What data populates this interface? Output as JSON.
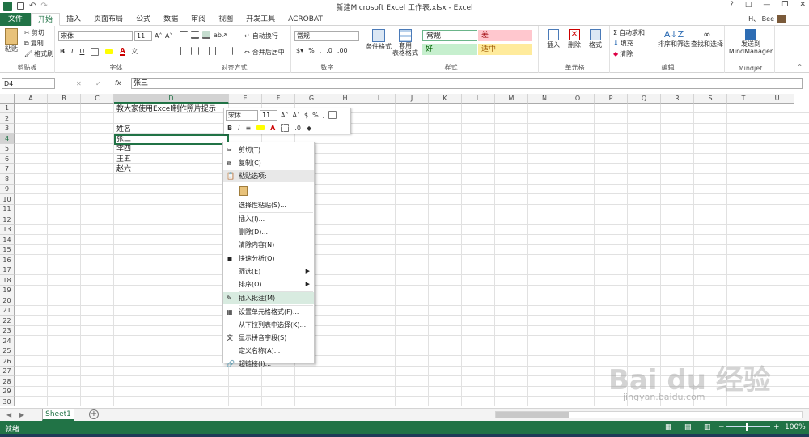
{
  "window": {
    "title": "新建Microsoft Excel 工作表.xlsx - Excel",
    "controls": [
      "?",
      "□",
      "—",
      "❐",
      "✕"
    ],
    "user": "H、 Bee"
  },
  "tabs": [
    "文件",
    "开始",
    "插入",
    "页面布局",
    "公式",
    "数据",
    "审阅",
    "视图",
    "开发工具",
    "ACROBAT"
  ],
  "ribbon": {
    "clipboard": {
      "paste": "粘贴",
      "cut": "剪切",
      "copy": "复制",
      "format_painter": "格式刷",
      "label": "剪贴板"
    },
    "font": {
      "name": "宋体",
      "size": "11",
      "label": "字体",
      "bold": "B",
      "italic": "I",
      "underline": "U",
      "grow": "A˄",
      "shrink": "A˅"
    },
    "alignment": {
      "wrap": "自动换行",
      "merge": "合并后居中",
      "label": "对齐方式"
    },
    "number": {
      "format": "常规",
      "percent": "%",
      "comma": ",",
      "label": "数字"
    },
    "styles": {
      "cond": "条件格式",
      "table": "套用\n表格格式",
      "normal": "常规",
      "bad": "差",
      "good": "好",
      "neutral": "适中",
      "label": "样式"
    },
    "cells": {
      "insert": "插入",
      "delete": "删除",
      "format": "格式",
      "label": "单元格"
    },
    "editing": {
      "autosum": "自动求和",
      "fill": "填充",
      "clear": "清除",
      "sort": "排序和筛选",
      "find": "查找和选择",
      "label": "编辑"
    },
    "mindjet": {
      "send": "发送到\nMindManager",
      "label": "Mindjet"
    }
  },
  "formula_bar": {
    "name_box": "D4",
    "fx": "fx",
    "content": "张三"
  },
  "columns": [
    "A",
    "B",
    "C",
    "D",
    "E",
    "F",
    "G",
    "H",
    "I",
    "J",
    "K",
    "L",
    "M",
    "N",
    "O",
    "P",
    "Q",
    "R",
    "S",
    "T",
    "U"
  ],
  "rows": [
    "1",
    "2",
    "3",
    "4",
    "5",
    "6",
    "7",
    "8",
    "9",
    "10",
    "11",
    "12",
    "13",
    "14",
    "15",
    "16",
    "17",
    "18",
    "19",
    "20",
    "21",
    "22",
    "23",
    "24",
    "25",
    "26",
    "27",
    "28",
    "29",
    "30"
  ],
  "cells": {
    "D1": "教大家使用Excel制作照片提示",
    "D3": "姓名",
    "D4": "张三",
    "D5": "李四",
    "D6": "王五",
    "D7": "赵六"
  },
  "mini_toolbar": {
    "font": "宋体",
    "size": "11"
  },
  "context_menu": [
    {
      "label": "剪切(T)",
      "icon": "scissors-icon"
    },
    {
      "label": "复制(C)",
      "icon": "copy-icon"
    },
    {
      "label": "粘贴选项:",
      "icon": "paste-icon",
      "header": true
    },
    {
      "label": "",
      "icon": "paste-option-icon",
      "pasteopt": true
    },
    {
      "label": "选择性粘贴(S)..."
    },
    {
      "label": "插入(I)..."
    },
    {
      "label": "删除(D)..."
    },
    {
      "label": "清除内容(N)"
    },
    {
      "label": "快速分析(Q)",
      "icon": "quick-analysis-icon"
    },
    {
      "label": "筛选(E)",
      "submenu": true
    },
    {
      "label": "排序(O)",
      "submenu": true
    },
    {
      "label": "插入批注(M)",
      "icon": "comment-icon",
      "highlight": true
    },
    {
      "label": "设置单元格格式(F)...",
      "icon": "format-cells-icon"
    },
    {
      "label": "从下拉列表中选择(K)..."
    },
    {
      "label": "显示拼音字段(S)",
      "icon": "phonetic-icon"
    },
    {
      "label": "定义名称(A)..."
    },
    {
      "label": "超链接(I)...",
      "icon": "hyperlink-icon"
    }
  ],
  "sheets": [
    "Sheet1"
  ],
  "status": {
    "ready": "就绪",
    "zoom": "100%"
  },
  "watermark": {
    "text": "Bai du 经验",
    "url": "jingyan.baidu.com"
  },
  "colors": {
    "excel_green": "#217346",
    "bad_bg": "#ffc7ce",
    "good_bg": "#c6efce",
    "neutral_bg": "#ffeb9c"
  }
}
